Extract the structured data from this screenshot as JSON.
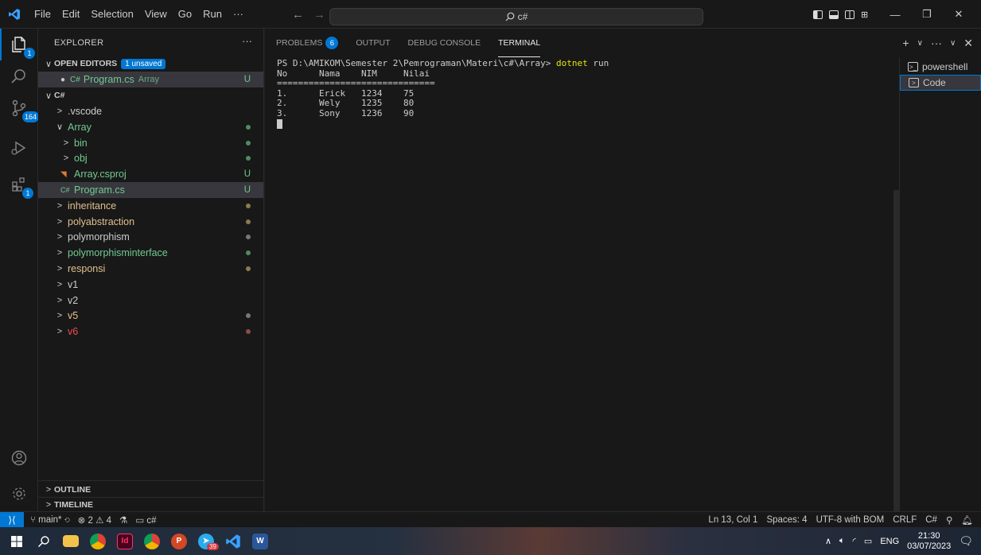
{
  "menu": [
    "File",
    "Edit",
    "Selection",
    "View",
    "Go",
    "Run",
    "···"
  ],
  "search": {
    "text": "c#"
  },
  "activity_badges": {
    "explorer": "1",
    "source_control": "164",
    "extensions": "1"
  },
  "sidebar": {
    "title": "EXPLORER",
    "open_editors": {
      "label": "OPEN EDITORS",
      "badge": "1 unsaved"
    },
    "open_file": {
      "name": "Program.cs",
      "folder": "Array",
      "status": "U"
    },
    "root": "C#",
    "items": [
      {
        "label": ".vscode",
        "type": "folder",
        "depth": 1,
        "open": false,
        "color": "#cccccc"
      },
      {
        "label": "Array",
        "type": "folder",
        "depth": 1,
        "open": true,
        "color": "#73c991",
        "dot": "#4f8a66"
      },
      {
        "label": "bin",
        "type": "folder",
        "depth": 2,
        "open": false,
        "color": "#73c991",
        "dot": "#4f8a66"
      },
      {
        "label": "obj",
        "type": "folder",
        "depth": 2,
        "open": false,
        "color": "#73c991",
        "dot": "#4f8a66"
      },
      {
        "label": "Array.csproj",
        "type": "file",
        "depth": 2,
        "color": "#73c991",
        "status": "U",
        "icon": "rss"
      },
      {
        "label": "Program.cs",
        "type": "file",
        "depth": 2,
        "color": "#73c991",
        "status": "U",
        "icon": "csharp",
        "selected": true
      },
      {
        "label": "inheritance",
        "type": "folder",
        "depth": 1,
        "open": false,
        "color": "#e2c08d",
        "dot": "#8d7a50"
      },
      {
        "label": "polyabstraction",
        "type": "folder",
        "depth": 1,
        "open": false,
        "color": "#e2c08d",
        "dot": "#8d7a50"
      },
      {
        "label": "polymorphism",
        "type": "folder",
        "depth": 1,
        "open": false,
        "color": "#cccccc",
        "dot": "#777777"
      },
      {
        "label": "polymorphisminterface",
        "type": "folder",
        "depth": 1,
        "open": false,
        "color": "#73c991",
        "dot": "#4f8a66"
      },
      {
        "label": "responsi",
        "type": "folder",
        "depth": 1,
        "open": false,
        "color": "#e2c08d",
        "dot": "#8d7a50"
      },
      {
        "label": "v1",
        "type": "folder",
        "depth": 1,
        "open": false,
        "color": "#cccccc"
      },
      {
        "label": "v2",
        "type": "folder",
        "depth": 1,
        "open": false,
        "color": "#cccccc"
      },
      {
        "label": "v5",
        "type": "folder",
        "depth": 1,
        "open": false,
        "color": "#e2c08d",
        "dot": "#777777"
      },
      {
        "label": "v6",
        "type": "folder",
        "depth": 1,
        "open": false,
        "color": "#f14c4c",
        "dot": "#8d4a4a"
      }
    ],
    "outline": "OUTLINE",
    "timeline": "TIMELINE"
  },
  "panel": {
    "tabs": [
      {
        "label": "PROBLEMS",
        "badge": "6"
      },
      {
        "label": "OUTPUT"
      },
      {
        "label": "DEBUG CONSOLE"
      },
      {
        "label": "TERMINAL",
        "active": true
      }
    ],
    "terminal": {
      "prompt": "PS D:\\AMIKOM\\Semester 2\\Pemrograman\\Materi\\c#\\Array> ",
      "command": "dotnet",
      "command_arg": " run",
      "lines": [
        "No      Nama    NIM     Nilai",
        "==============================",
        "1.      Erick   1234    75",
        "2.      Wely    1235    80",
        "3.      Sony    1236    90"
      ]
    },
    "terminal_list": [
      "powershell",
      "Code"
    ]
  },
  "statusbar": {
    "branch": "main*",
    "errors": "2",
    "warnings": "4",
    "workspace": "c#",
    "position": "Ln 13, Col 1",
    "spaces": "Spaces: 4",
    "encoding": "UTF-8 with BOM",
    "eol": "CRLF",
    "language": "C#"
  },
  "taskbar": {
    "telegram_badge": "39",
    "lang": "ENG",
    "time": "21:30",
    "date": "03/07/2023"
  },
  "colors": {
    "accent": "#0078d4",
    "terminal_cmd": "#e5e510",
    "git_untracked": "#73c991",
    "git_modified": "#e2c08d"
  }
}
